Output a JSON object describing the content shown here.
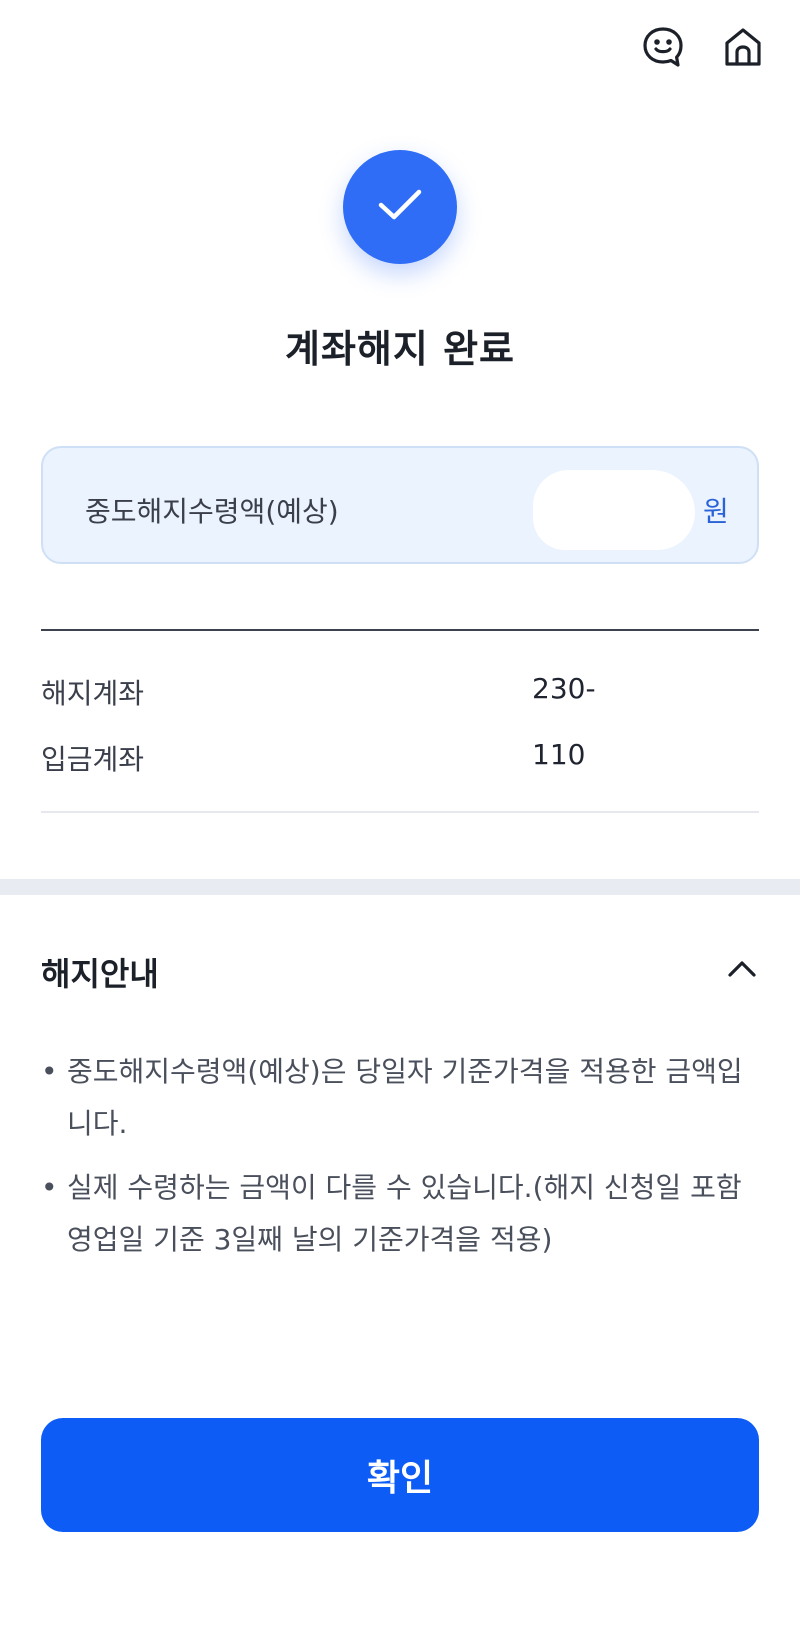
{
  "header": {
    "chat_icon": "smile-chat-icon",
    "home_icon": "home-icon"
  },
  "status": {
    "icon": "check-icon",
    "title": "계좌해지 완료"
  },
  "amount": {
    "label": "중도해지수령액(예상)",
    "unit": "원"
  },
  "accounts": {
    "rows": [
      {
        "label": "해지계좌",
        "value": "230-"
      },
      {
        "label": "입금계좌",
        "value": "110"
      }
    ]
  },
  "notice": {
    "title": "해지안내",
    "items": [
      "중도해지수령액(예상)은 당일자 기준가격을 적용한 금액입니다.",
      "실제 수령하는 금액이 다를 수 있습니다.(해지 신청일 포함 영업일 기준 3일째 날의 기준가격을 적용)"
    ]
  },
  "confirm_button": {
    "label": "확인"
  },
  "colors": {
    "primary": "#0d5cf5",
    "check_circle": "#2f6df6",
    "amount_bg": "#eaf3fe",
    "amount_unit": "#2a62d8"
  }
}
